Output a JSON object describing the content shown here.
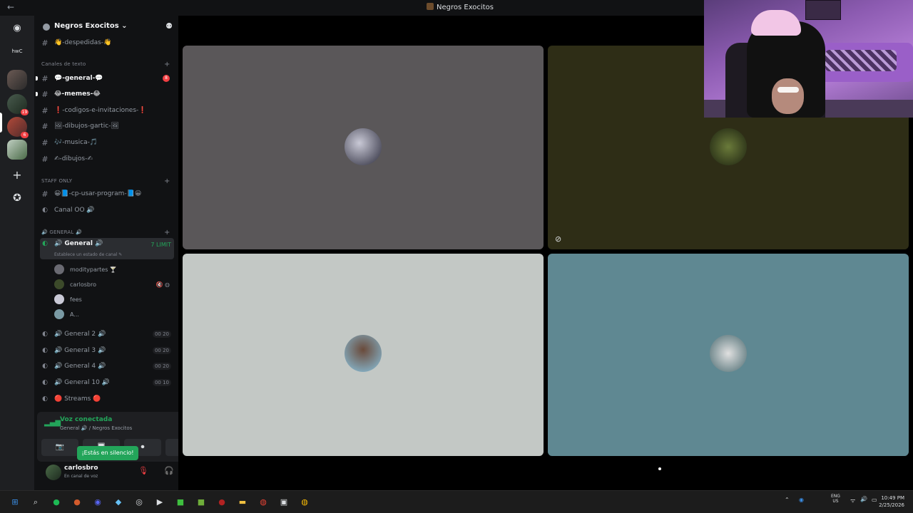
{
  "window": {
    "title": "Negros Exocitos",
    "back_glyph": "←"
  },
  "servers": {
    "discord_glyph": "◉",
    "shortcut_label": "hwC",
    "badges": [
      "19",
      "6"
    ],
    "plus_glyph": "+",
    "compass_glyph": "✪"
  },
  "sidebar": {
    "guild_name": "Negros Exocitos ⌄",
    "invite_glyph": "⚉",
    "top_channel": "👋-despedidas-👋",
    "category_text": "Canales de texto",
    "text_channels": [
      {
        "label": "💬-general-💬",
        "unread": true,
        "mentions": "8"
      },
      {
        "label": "😂-memes-😂",
        "unread": true
      },
      {
        "label": "❗-codigos-e-invitaciones-❗",
        "unread": false
      },
      {
        "label": "🖼-dibujos-gartic-🖼",
        "unread": false
      },
      {
        "label": "🎶-musica-🎵",
        "unread": false
      },
      {
        "label": "✍-dibujos-✍",
        "unread": false
      }
    ],
    "category_staff": "STAFF ONLY",
    "staff_channels": [
      {
        "label": "😀📘-cp-usar-program-📘😀",
        "type": "text"
      },
      {
        "label": "Canal OO 🔊",
        "type": "voice"
      }
    ],
    "category_general": "🔊 GENERAL 🔊",
    "active_voice": {
      "label": "🔊 General 🔊",
      "status": "Establece un estado de canal ✎",
      "right": "7 LIMIT"
    },
    "voice_users": [
      {
        "name": "moditypartes 🍸",
        "icons": ""
      },
      {
        "name": "carlosbro",
        "icons": "🔇 ◍"
      },
      {
        "name": "fees",
        "icons": ""
      },
      {
        "name": "A...",
        "icons": ""
      }
    ],
    "voice_channels": [
      {
        "label": "🔊 General 2 🔊",
        "badge": "00 20"
      },
      {
        "label": "🔊 General 3 🔊",
        "badge": "00 20"
      },
      {
        "label": "🔊 General 4 🔊",
        "badge": "00 20"
      },
      {
        "label": "🔊 General 10 🔊",
        "badge": "00 10"
      },
      {
        "label": "🔴 Streams 🔴",
        "badge": ""
      }
    ]
  },
  "voice_panel": {
    "title": "Voz conectada",
    "subtitle": "General 🔊 / Negros Exocitos",
    "signal_glyph": "▂▄▆",
    "noise_glyph": "⌁",
    "disconnect_glyph": "☎",
    "buttons": [
      "📷",
      "🖥",
      "⏺",
      "🎛"
    ],
    "tooltip": "¡Estás en silencio!"
  },
  "user_panel": {
    "name": "carlosbro",
    "status": "En canal de voz",
    "mic_glyph": "🎙",
    "headset_glyph": "🎧",
    "gear_glyph": "⚙"
  },
  "stage": {
    "tile_colors": [
      "#5a5759",
      "#2e2d16",
      "#c3c8c5",
      "#5f8892"
    ],
    "tile_icon": "⊘"
  },
  "taskbar": {
    "icons": [
      {
        "name": "windows-start",
        "glyph": "⊞",
        "color": "#3a8ee6"
      },
      {
        "name": "search",
        "glyph": "⌕",
        "color": "#dbdee1"
      },
      {
        "name": "spotify",
        "glyph": "●",
        "color": "#1db954"
      },
      {
        "name": "app-orange",
        "glyph": "●",
        "color": "#d35b2c"
      },
      {
        "name": "discord",
        "glyph": "◉",
        "color": "#5865f2"
      },
      {
        "name": "steam",
        "glyph": "◆",
        "color": "#66c0f4"
      },
      {
        "name": "chrome-alt",
        "glyph": "◎",
        "color": "#dbdee1"
      },
      {
        "name": "media",
        "glyph": "▶",
        "color": "#dbdee1"
      },
      {
        "name": "green-app",
        "glyph": "■",
        "color": "#3fbf3f"
      },
      {
        "name": "minecraft",
        "glyph": "■",
        "color": "#6fae3a"
      },
      {
        "name": "red-app",
        "glyph": "●",
        "color": "#b22222"
      },
      {
        "name": "folder",
        "glyph": "▬",
        "color": "#f0c040"
      },
      {
        "name": "chrome",
        "glyph": "◍",
        "color": "#ea4335"
      },
      {
        "name": "terminal",
        "glyph": "▣",
        "color": "#dbdee1"
      },
      {
        "name": "chrome-2",
        "glyph": "◍",
        "color": "#fbbc05"
      }
    ],
    "tray_up": "⌃",
    "lang": "ENG\nUS",
    "wifi": "ᯤ",
    "sound": "🔊",
    "battery": "▭",
    "time": "10:49 PM",
    "date": "2/25/2026"
  }
}
